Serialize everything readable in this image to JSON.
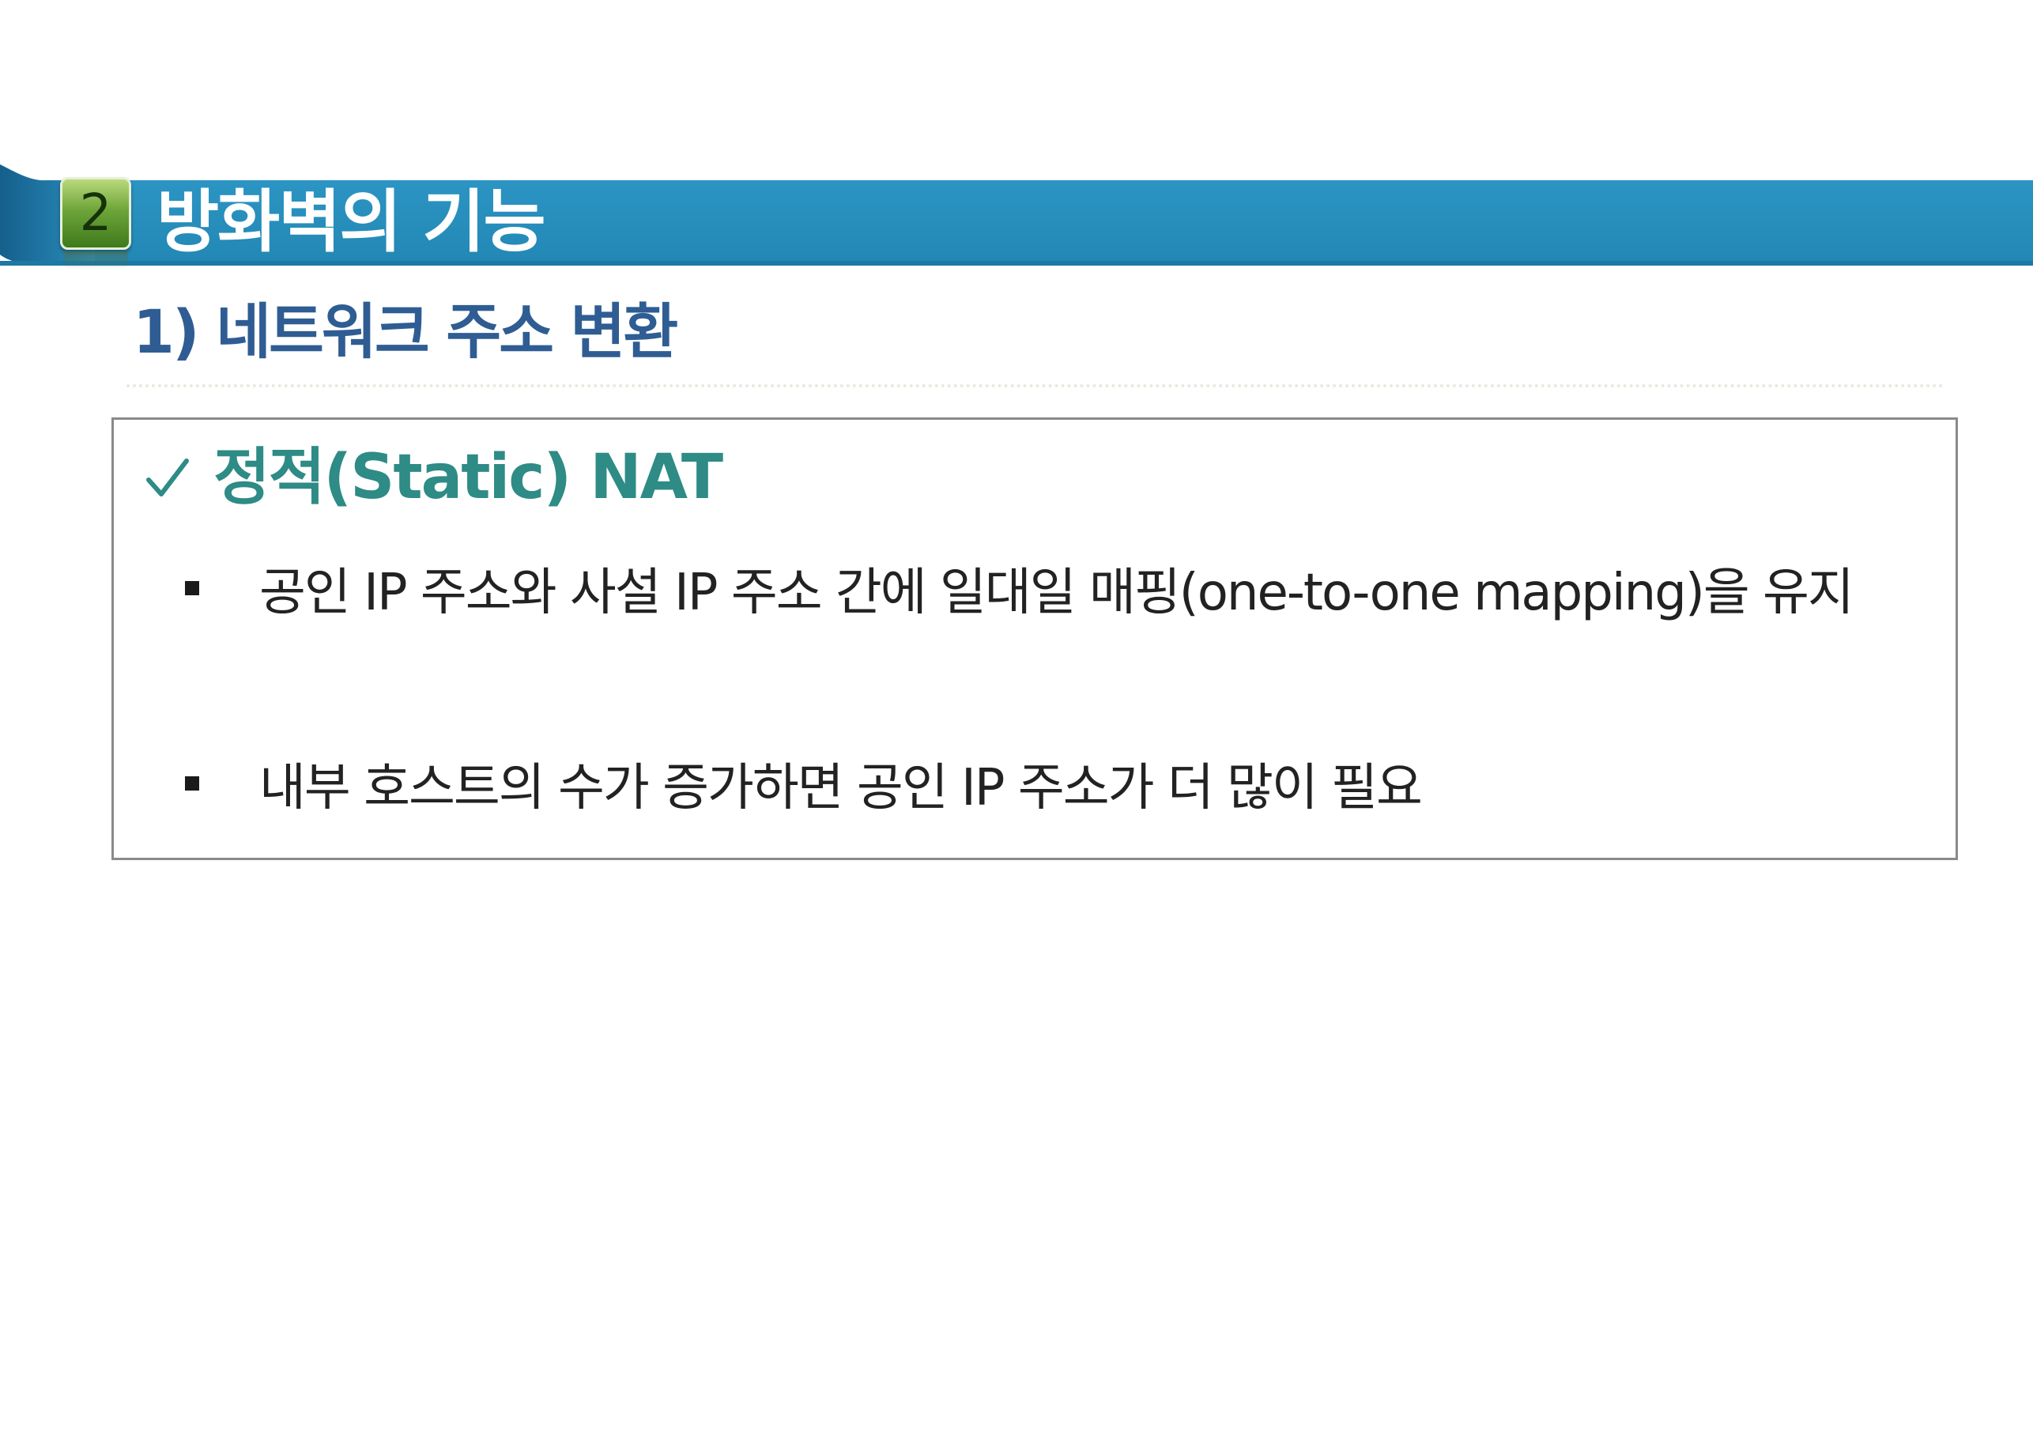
{
  "header": {
    "badge_number": "2",
    "title": "방화벽의 기능",
    "banner_color": "#2a8fbd",
    "badge_color": "#6ea53a"
  },
  "section": {
    "title": "1) 네트워크 주소 변환",
    "title_color": "#2f5d93"
  },
  "content": {
    "heading_icon": "check-icon",
    "heading": "정적(Static) NAT",
    "heading_color": "#2e8b85",
    "bullets": [
      {
        "text": "공인 IP 주소와 사설 IP 주소 간에 일대일 매핑(one-to-one mapping)을 유지"
      },
      {
        "text": "내부 호스트의 수가 증가하면 공인 IP 주소가 더 많이 필요"
      }
    ]
  }
}
